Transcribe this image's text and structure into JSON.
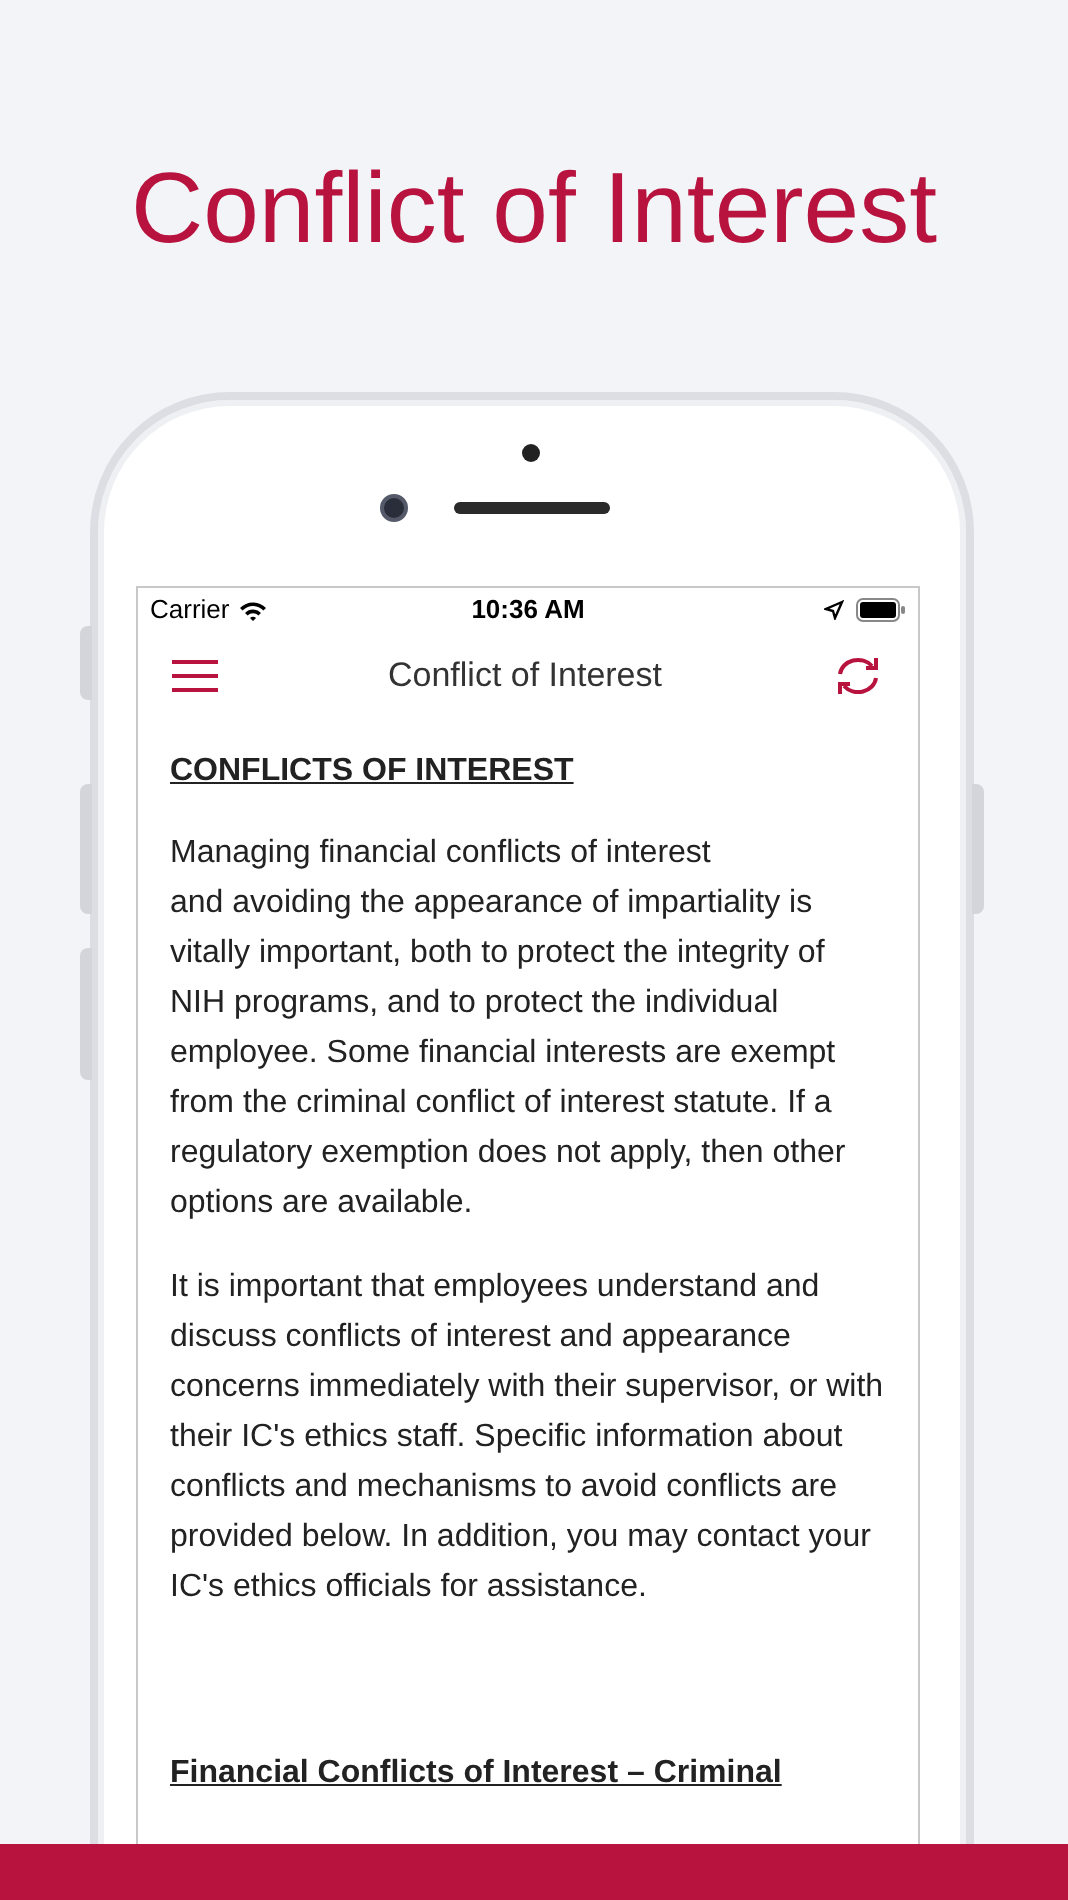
{
  "headline": "Conflict of Interest",
  "status_bar": {
    "carrier": "Carrier",
    "time": "10:36 AM"
  },
  "nav_bar": {
    "title": "Conflict of Interest"
  },
  "content": [
    {
      "kind": "heading",
      "text": "CONFLICTS OF INTEREST"
    },
    {
      "kind": "paragraph",
      "text": "Managing financial conflicts of interest\nand avoiding the appearance of impartiality is vitally important, both to protect the integrity of NIH programs, and to protect the individual employee. Some financial interests are exempt from the criminal conflict of interest statute. If a regulatory exemption does not apply, then other options are available."
    },
    {
      "kind": "paragraph",
      "text": "It is important that employees understand and discuss conflicts of interest and appearance concerns immediately with their supervisor, or with their IC's ethics staff. Specific information about conflicts and mechanisms to avoid conflicts are provided below. In addition, you may contact your IC's ethics officials for assistance."
    },
    {
      "kind": "heading",
      "text": "Financial Conflicts of Interest – Criminal"
    }
  ]
}
